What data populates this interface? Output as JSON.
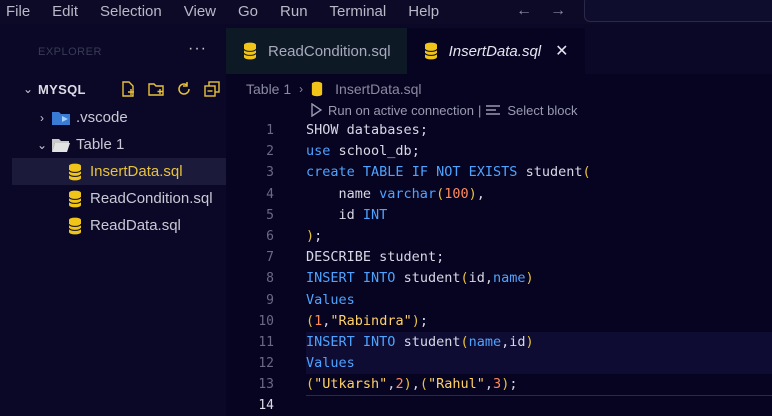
{
  "menubar": {
    "items": [
      "File",
      "Edit",
      "Selection",
      "View",
      "Go",
      "Run",
      "Terminal",
      "Help"
    ]
  },
  "sidebar": {
    "title": "EXPLORER",
    "folder": "MYSQL",
    "items": [
      {
        "label": ".vscode",
        "type": "folder-collapsed"
      },
      {
        "label": "Table 1",
        "type": "folder-open"
      },
      {
        "label": "InsertData.sql",
        "type": "sql",
        "selected": true
      },
      {
        "label": "ReadCondition.sql",
        "type": "sql"
      },
      {
        "label": "ReadData.sql",
        "type": "sql"
      }
    ]
  },
  "tabs": [
    {
      "label": "ReadCondition.sql",
      "active": false
    },
    {
      "label": "InsertData.sql",
      "active": true
    }
  ],
  "breadcrumb": {
    "folder": "Table 1",
    "file": "InsertData.sql"
  },
  "codelens": {
    "run": "Run on active connection",
    "divider": "|",
    "select": "Select block"
  },
  "editor": {
    "line_numbers": [
      "1",
      "2",
      "3",
      "4",
      "5",
      "6",
      "7",
      "8",
      "9",
      "10",
      "11",
      "12",
      "13",
      "14"
    ],
    "current_line": 14,
    "lines": [
      "SHOW databases;",
      "use school_db;",
      "create TABLE IF NOT EXISTS student(",
      "    name varchar(100),",
      "    id INT",
      ");",
      "DESCRIBE student;",
      "INSERT INTO student(id,name)",
      "Values",
      "(1,\"Rabindra\");",
      "INSERT INTO student(name,id)",
      "Values",
      "(\"Utkarsh\",2),(\"Rahul\",3);",
      ""
    ]
  },
  "colors": {
    "keyword": "#4fa3ff",
    "bracket": "#e8c23a",
    "number": "#ff8a5c",
    "string": "#ffd166",
    "selected_file": "#e8c23a"
  }
}
